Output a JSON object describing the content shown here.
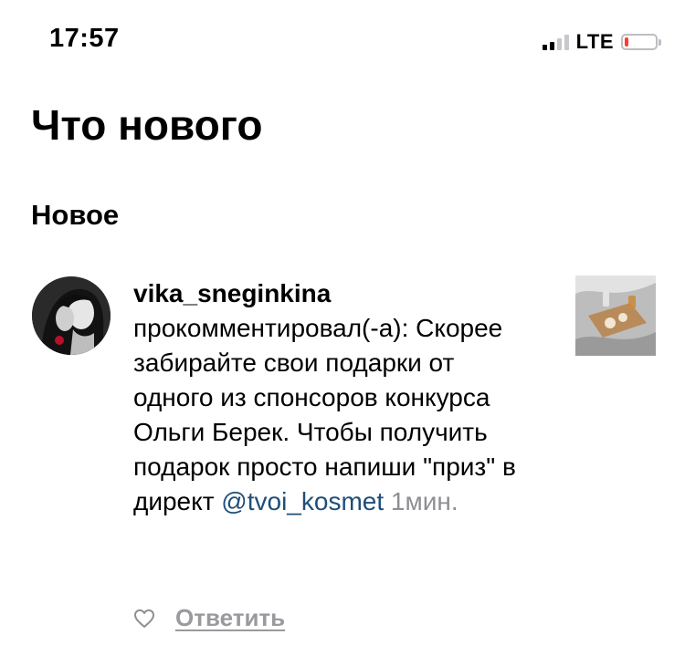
{
  "status_bar": {
    "time": "17:57",
    "network": "LTE",
    "battery_color": "#ff3b30"
  },
  "header": {
    "title": "Что нового"
  },
  "section": {
    "title": "Новое"
  },
  "activity": {
    "username": "vika_sneginkina",
    "action": "прокомментировал(-а):",
    "comment": "Скорее забирайте свои подарки от одного из спонсоров конкурса Ольги Берек. Чтобы получить подарок просто напиши \"приз\" в директ",
    "mention": "@tvoi_kosmet",
    "time": "1мин.",
    "reply_label": "Ответить",
    "like_icon": "heart-outline-icon",
    "mention_color": "#1f4e79"
  }
}
